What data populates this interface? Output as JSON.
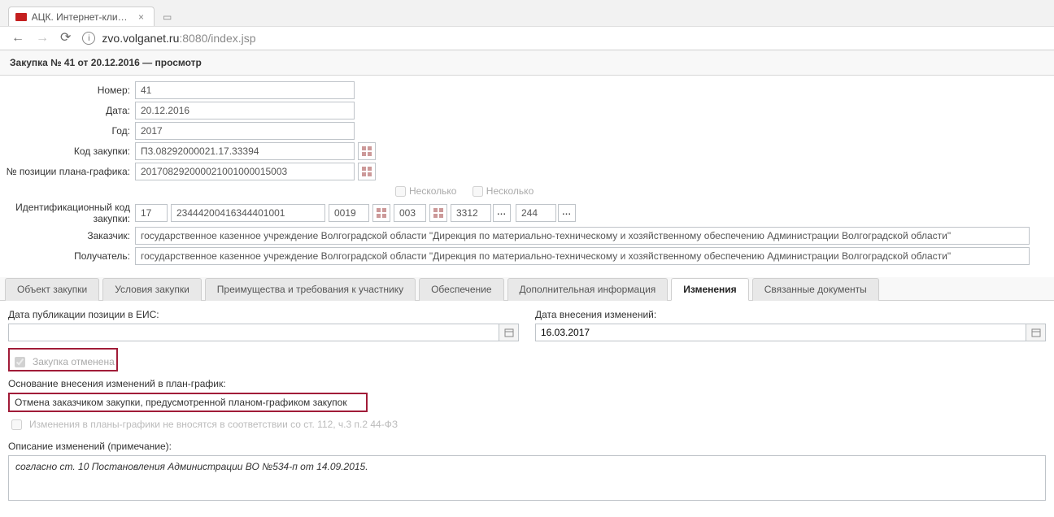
{
  "browser": {
    "tab_title": "АЦК. Интернет-клиент",
    "url_host": "zvo.volganet.ru",
    "url_port_path": ":8080/index.jsp"
  },
  "header": {
    "title": "Закупка № 41 от 20.12.2016 — просмотр"
  },
  "form": {
    "labels": {
      "number": "Номер:",
      "date": "Дата:",
      "year": "Год:",
      "code": "Код закупки:",
      "plan_pos": "№ позиции плана-графика:",
      "ikz": "Идентификационный код закупки:",
      "customer": "Заказчик:",
      "recipient": "Получатель:"
    },
    "number": "41",
    "date": "20.12.2016",
    "year": "2017",
    "code": "П3.08292000021.17.33394",
    "plan_pos": "201708292000021001000015003",
    "ikz": {
      "several1": "Несколько",
      "several2": "Несколько",
      "p1": "17",
      "p2": "23444200416344401001",
      "p3": "0019",
      "p4": "003",
      "p5": "3312",
      "p6": "244"
    },
    "customer": "государственное казенное учреждение Волгоградской области \"Дирекция по материально-техническому и хозяйственному обеспечению Администрации Волгоградской области\"",
    "recipient": "государственное казенное учреждение Волгоградской области \"Дирекция по материально-техническому и хозяйственному обеспечению Администрации Волгоградской области\""
  },
  "tabs": {
    "t0": "Объект закупки",
    "t1": "Условия закупки",
    "t2": "Преимущества и требования к участнику",
    "t3": "Обеспечение",
    "t4": "Дополнительная информация",
    "t5": "Изменения",
    "t6": "Связанные документы"
  },
  "changes": {
    "pub_date_label": "Дата публикации позиции в ЕИС:",
    "pub_date": "",
    "change_date_label": "Дата внесения изменений:",
    "change_date": "16.03.2017",
    "cancelled_chk": "Закупка отменена",
    "reason_label": "Основание внесения изменений в план-график:",
    "reason": "Отмена заказчиком закупки, предусмотренной планом-графиком закупок",
    "disabled_line": "Изменения в планы-графики не вносятся в соответствии со ст. 112, ч.3 п.2 44-ФЗ",
    "desc_label": "Описание изменений (примечание):",
    "desc": "согласно ст. 10 Постановления Администрации ВО №534-п от 14.09.2015."
  }
}
